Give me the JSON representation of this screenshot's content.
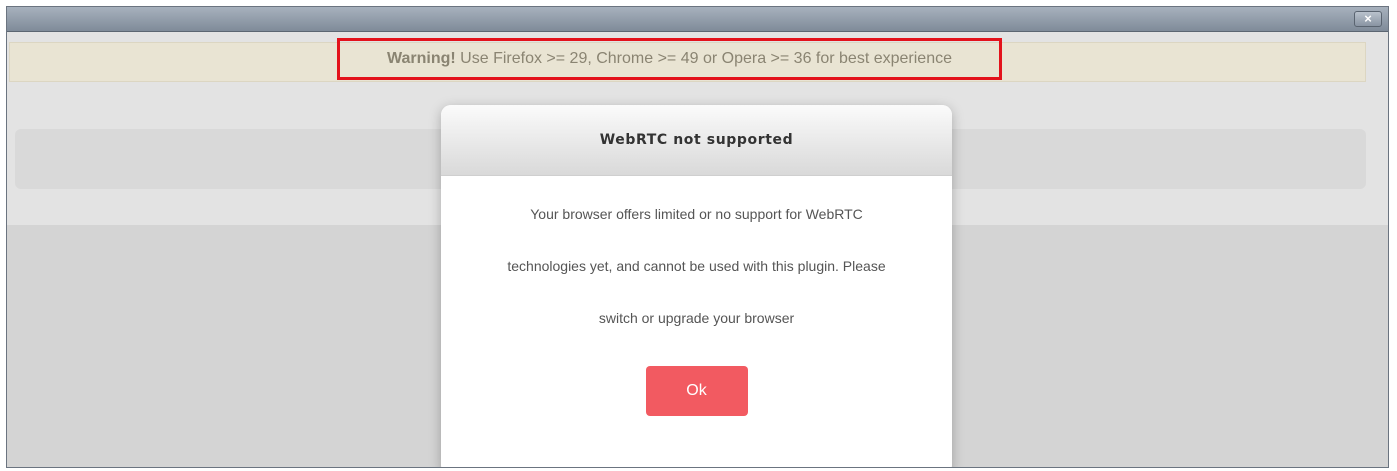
{
  "window": {
    "close_label": "×"
  },
  "warning": {
    "bold": "Warning!",
    "text": " Use Firefox >= 29, Chrome >= 49 or Opera >= 36 for best experience"
  },
  "modal": {
    "title": "WebRTC not supported",
    "lines": [
      "Your browser offers limited or no support for WebRTC",
      "technologies yet, and cannot be used with this plugin. Please",
      "switch or upgrade your browser"
    ],
    "ok_label": "Ok"
  },
  "colors": {
    "warning_border": "#e3121b",
    "ok_button": "#f25a61"
  }
}
